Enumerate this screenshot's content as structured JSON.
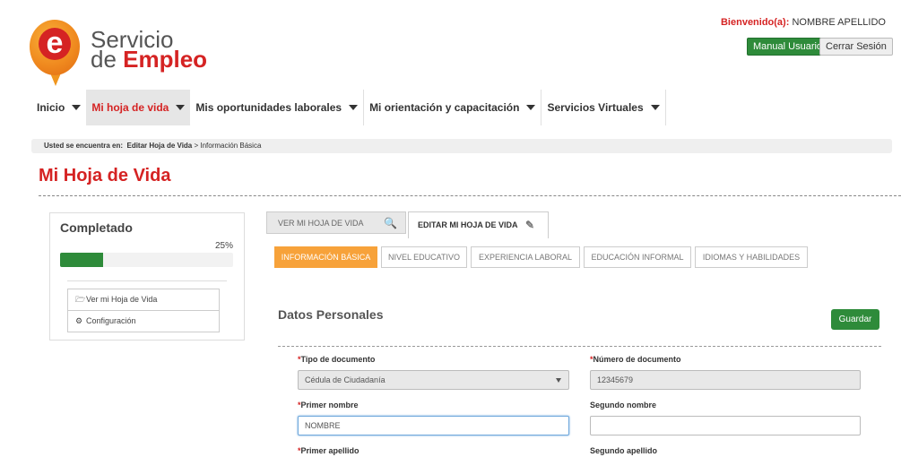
{
  "header": {
    "logo_line1": "Servicio",
    "logo_line2_prefix": "de",
    "logo_line2_brand": "Empleo",
    "logo_letter": "e",
    "welcome_label": "Bienvenido(a):",
    "welcome_name": "NOMBRE APELLIDO",
    "manual_button": "Manual Usuario",
    "logout_button": "Cerrar Sesión"
  },
  "nav": {
    "items": [
      {
        "label": "Inicio"
      },
      {
        "label": "Mi hoja de vida"
      },
      {
        "label": "Mis oportunidades laborales"
      },
      {
        "label": "Mi orientación y capacitación"
      },
      {
        "label": "Servicios Virtuales"
      }
    ],
    "active_index": 1
  },
  "breadcrumb": {
    "prefix": "Usted se encuentra en:",
    "path_bold": "Editar Hoja de Vida",
    "separator": " > ",
    "current": "Información Básica"
  },
  "page_title": "Mi Hoja de Vida",
  "sidebar": {
    "completed_label": "Completado",
    "percent_text": "25%",
    "progress": 0.25,
    "items": [
      {
        "icon": "folder-open-icon",
        "label": "Ver mi Hoja de Vida"
      },
      {
        "icon": "gear-icon",
        "label": "Configuración"
      }
    ]
  },
  "tabs": {
    "view": "VER MI HOJA DE VIDA",
    "edit": "EDITAR MI HOJA DE VIDA"
  },
  "subtabs": [
    {
      "label": "INFORMACIÓN BÁSICA",
      "active": true
    },
    {
      "label": "NIVEL EDUCATIVO",
      "active": false
    },
    {
      "label": "EXPERIENCIA LABORAL",
      "active": false
    },
    {
      "label": "EDUCACIÓN INFORMAL",
      "active": false
    },
    {
      "label": "IDIOMAS Y HABILIDADES",
      "active": false
    }
  ],
  "form": {
    "section_title": "Datos Personales",
    "save_button": "Guardar",
    "tipo_documento_label": "Tipo de documento",
    "tipo_documento_value": "Cédula de Ciudadanía",
    "numero_documento_label": "Número de documento",
    "numero_documento_value": "12345679",
    "primer_nombre_label": "Primer nombre",
    "primer_nombre_value": "NOMBRE",
    "segundo_nombre_label": "Segundo nombre",
    "segundo_nombre_value": "",
    "primer_apellido_label": "Primer apellido",
    "segundo_apellido_label": "Segundo apellido",
    "required_mark": "*"
  },
  "colors": {
    "brand_red": "#d52323",
    "brand_orange": "#f7a23a",
    "green": "#2e8b3a"
  }
}
